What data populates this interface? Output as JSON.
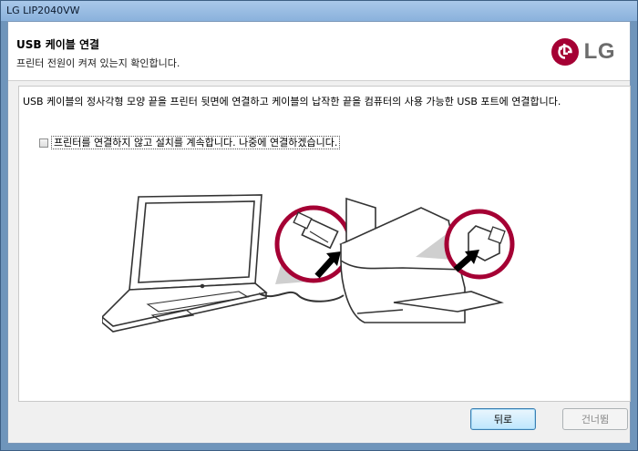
{
  "window": {
    "title": "LG LIP2040VW"
  },
  "header": {
    "title": "USB 케이블 연결",
    "subtitle": "프린터 전원이 켜져 있는지 확인합니다.",
    "logo_text": "LG"
  },
  "content": {
    "instruction": "USB 케이블의 정사각형 모양 끝을 프린터 뒷면에 연결하고 케이블의 납작한 끝을 컴퓨터의 사용 가능한 USB 포트에 연결합니다.",
    "checkbox_label": "프린터를 연결하지 않고 설치를 계속합니다. 나중에 연결하겠습니다.",
    "checkbox_checked": false
  },
  "footer": {
    "back_label": "뒤로",
    "skip_label": "건너뜀"
  },
  "colors": {
    "logo_red": "#a50034",
    "accent_blue": "#3c7fb1"
  }
}
